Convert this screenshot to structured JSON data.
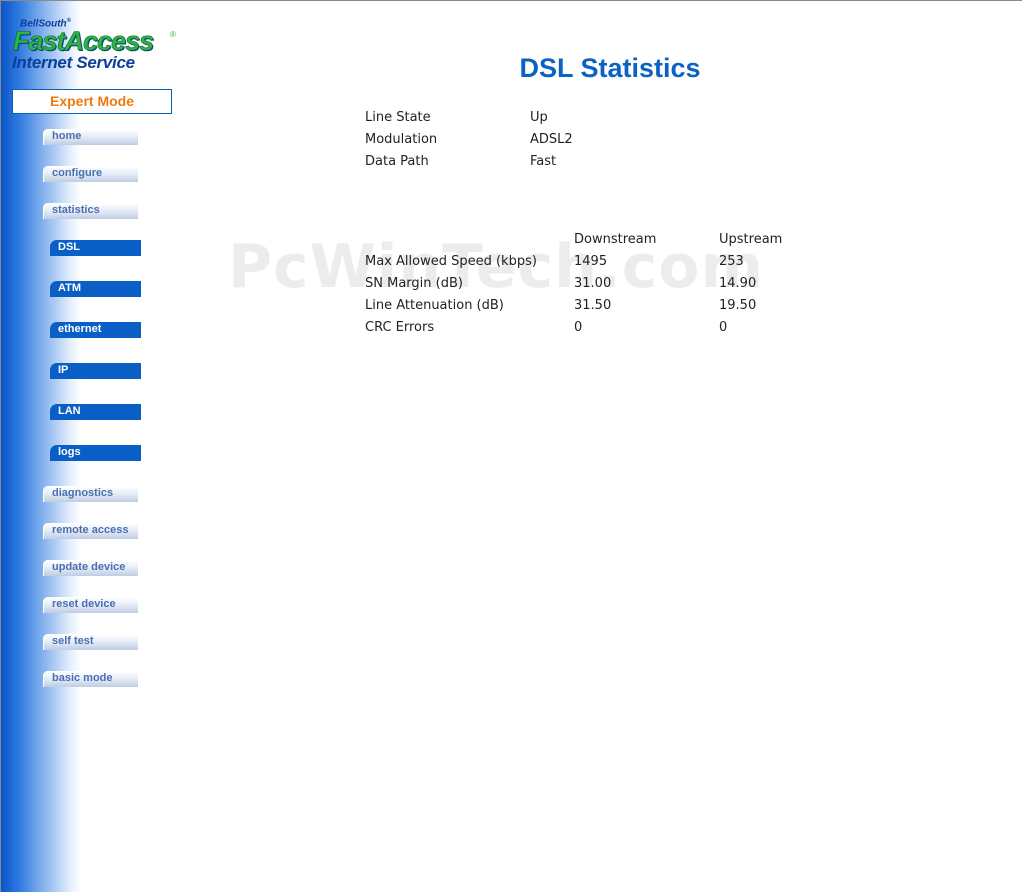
{
  "logo": {
    "brand_small": "BellSouth",
    "brand_mark": "®",
    "brand_main": "FastAccess",
    "brand_reg": "®",
    "brand_sub": "Internet Service"
  },
  "mode": "Expert Mode",
  "nav": {
    "home": "home",
    "configure": "configure",
    "statistics": "statistics",
    "dsl": "DSL",
    "atm": "ATM",
    "ethernet": "ethernet",
    "ip": "IP",
    "lan": "LAN",
    "logs": "logs",
    "diagnostics": "diagnostics",
    "remote_access": "remote access",
    "update_device": "update device",
    "reset_device": "reset device",
    "self_test": "self test",
    "basic_mode": "basic mode"
  },
  "page_title": "DSL Statistics",
  "watermark": "PcWinTech.com",
  "line_info": {
    "state_label": "Line State",
    "state_value": "Up",
    "modulation_label": "Modulation",
    "modulation_value": "ADSL2",
    "path_label": "Data Path",
    "path_value": "Fast"
  },
  "stats": {
    "col_down": "Downstream",
    "col_up": "Upstream",
    "rows": [
      {
        "label": "Max Allowed Speed (kbps)",
        "down": "1495",
        "up": "253"
      },
      {
        "label": "SN Margin (dB)",
        "down": "31.00",
        "up": "14.90"
      },
      {
        "label": "Line Attenuation (dB)",
        "down": "31.50",
        "up": "19.50"
      },
      {
        "label": "CRC Errors",
        "down": "0",
        "up": "0"
      }
    ]
  },
  "colors": {
    "title": "#0a63c4",
    "mode_text": "#f07a10",
    "sidebar_blue": "#0a55c8",
    "sub_nav": "#0a5fc6"
  }
}
